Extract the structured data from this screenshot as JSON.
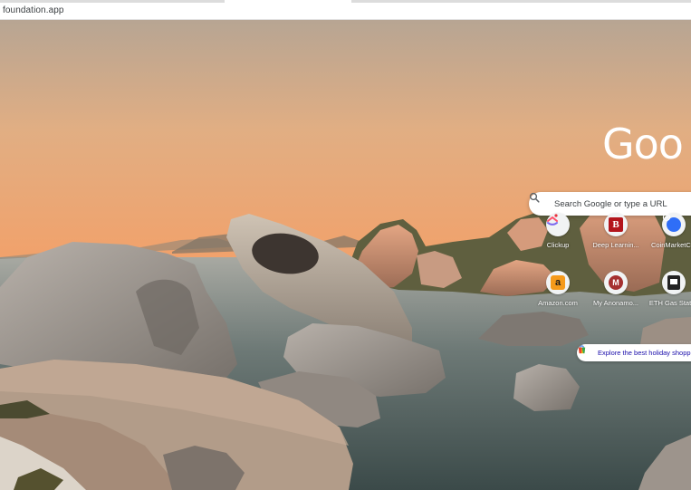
{
  "browser": {
    "address_text": "foundation.app"
  },
  "newtab": {
    "logo_text": "Goo",
    "search_placeholder": "Search Google or type a URL",
    "shortcuts": [
      {
        "label": "Clickup",
        "icon": "clickup-icon"
      },
      {
        "label": "Deep Learnin...",
        "icon": "deep-learning-icon"
      },
      {
        "label": "CoinMarketC...",
        "icon": "coinmarketcap-icon"
      },
      {
        "label": "Amazon.com",
        "icon": "amazon-icon"
      },
      {
        "label": "My Anonamo...",
        "icon": "m-letter-icon"
      },
      {
        "label": "ETH Gas Stati...",
        "icon": "eth-gas-icon"
      }
    ],
    "promo_text": "Explore the best holiday shopping",
    "colors": {
      "sky_top": "#b9a491",
      "sky_horizon": "#f0a46e",
      "water": "#6f7a76",
      "rock": "#a9a29b"
    }
  }
}
